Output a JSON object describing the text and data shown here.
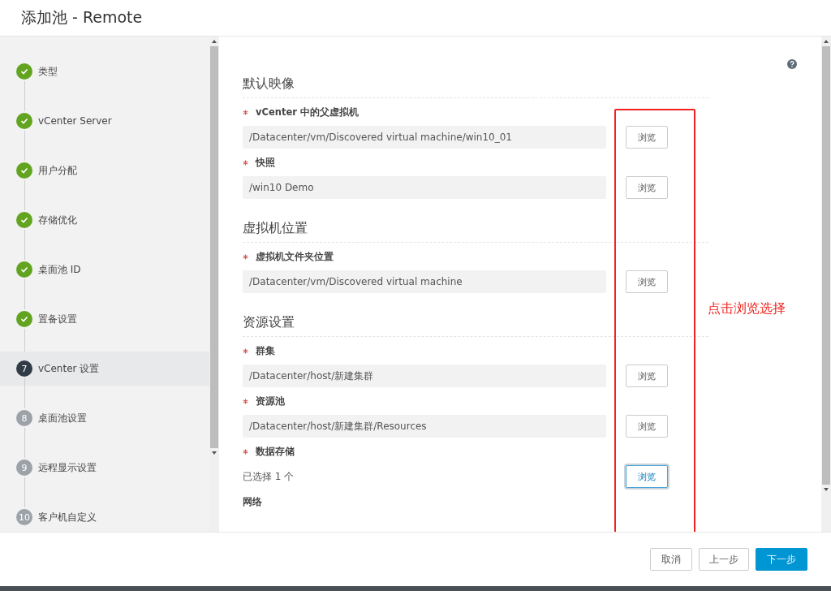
{
  "window": {
    "title": "添加池 - Remote"
  },
  "steps": [
    {
      "label": "类型",
      "completed": true,
      "selected": false
    },
    {
      "label": "vCenter Server",
      "completed": true,
      "selected": false
    },
    {
      "label": "用户分配",
      "completed": true,
      "selected": false
    },
    {
      "label": "存储优化",
      "completed": true,
      "selected": false
    },
    {
      "label": "桌面池 ID",
      "completed": true,
      "selected": false
    },
    {
      "label": "置备设置",
      "completed": true,
      "selected": false
    },
    {
      "label": "vCenter 设置",
      "number": "7",
      "completed": false,
      "selected": true
    },
    {
      "label": "桌面池设置",
      "number": "8",
      "completed": false,
      "selected": false
    },
    {
      "label": "远程显示设置",
      "number": "9",
      "completed": false,
      "selected": false
    },
    {
      "label": "客户机自定义",
      "number": "10",
      "completed": false,
      "selected": false
    }
  ],
  "sections": [
    {
      "title": "默认映像",
      "fields": [
        {
          "label": "vCenter 中的父虚拟机",
          "required": true,
          "kind": "input",
          "value": "/Datacenter/vm/Discovered virtual machine/win10_01",
          "button": {
            "label": "浏览",
            "focused": false
          }
        },
        {
          "label": "快照",
          "required": true,
          "kind": "input",
          "value": "/win10 Demo",
          "button": {
            "label": "浏览",
            "focused": false
          }
        }
      ]
    },
    {
      "title": "虚拟机位置",
      "fields": [
        {
          "label": "虚拟机文件夹位置",
          "required": true,
          "kind": "input",
          "value": "/Datacenter/vm/Discovered virtual machine",
          "button": {
            "label": "浏览",
            "focused": false
          }
        }
      ]
    },
    {
      "title": "资源设置",
      "fields": [
        {
          "label": "群集",
          "required": true,
          "kind": "input",
          "value": "/Datacenter/host/新建集群",
          "button": {
            "label": "浏览",
            "focused": false
          }
        },
        {
          "label": "资源池",
          "required": true,
          "kind": "input",
          "value": "/Datacenter/host/新建集群/Resources",
          "button": {
            "label": "浏览",
            "focused": false
          }
        },
        {
          "label": "数据存储",
          "required": true,
          "kind": "text",
          "value": "已选择 1 个",
          "button": {
            "label": "浏览",
            "focused": true
          }
        },
        {
          "label": "网络",
          "required": false,
          "kind": "label"
        }
      ]
    }
  ],
  "annotation": {
    "text": "点击浏览选择"
  },
  "footer": {
    "buttons": [
      {
        "label": "取消",
        "primary": false
      },
      {
        "label": "上一步",
        "primary": false
      },
      {
        "label": "下一步",
        "primary": true
      }
    ]
  }
}
